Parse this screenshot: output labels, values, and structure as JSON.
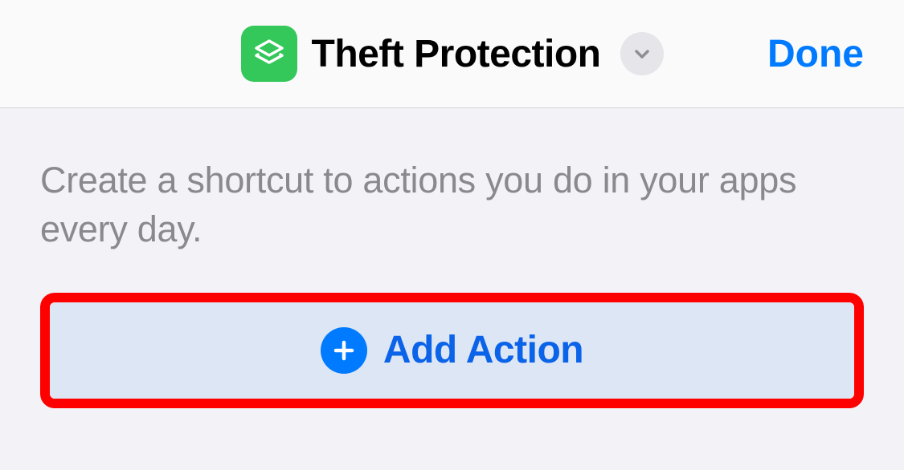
{
  "header": {
    "title": "Theft Protection",
    "done_label": "Done",
    "app_icon_name": "shortcuts-icon"
  },
  "content": {
    "description": "Create a shortcut to actions you do in your apps every day.",
    "add_action_label": "Add Action"
  },
  "colors": {
    "accent_blue": "#007aff",
    "app_icon_green": "#34c759",
    "highlight_red": "#ff0000",
    "button_bg": "#dde6f4"
  }
}
